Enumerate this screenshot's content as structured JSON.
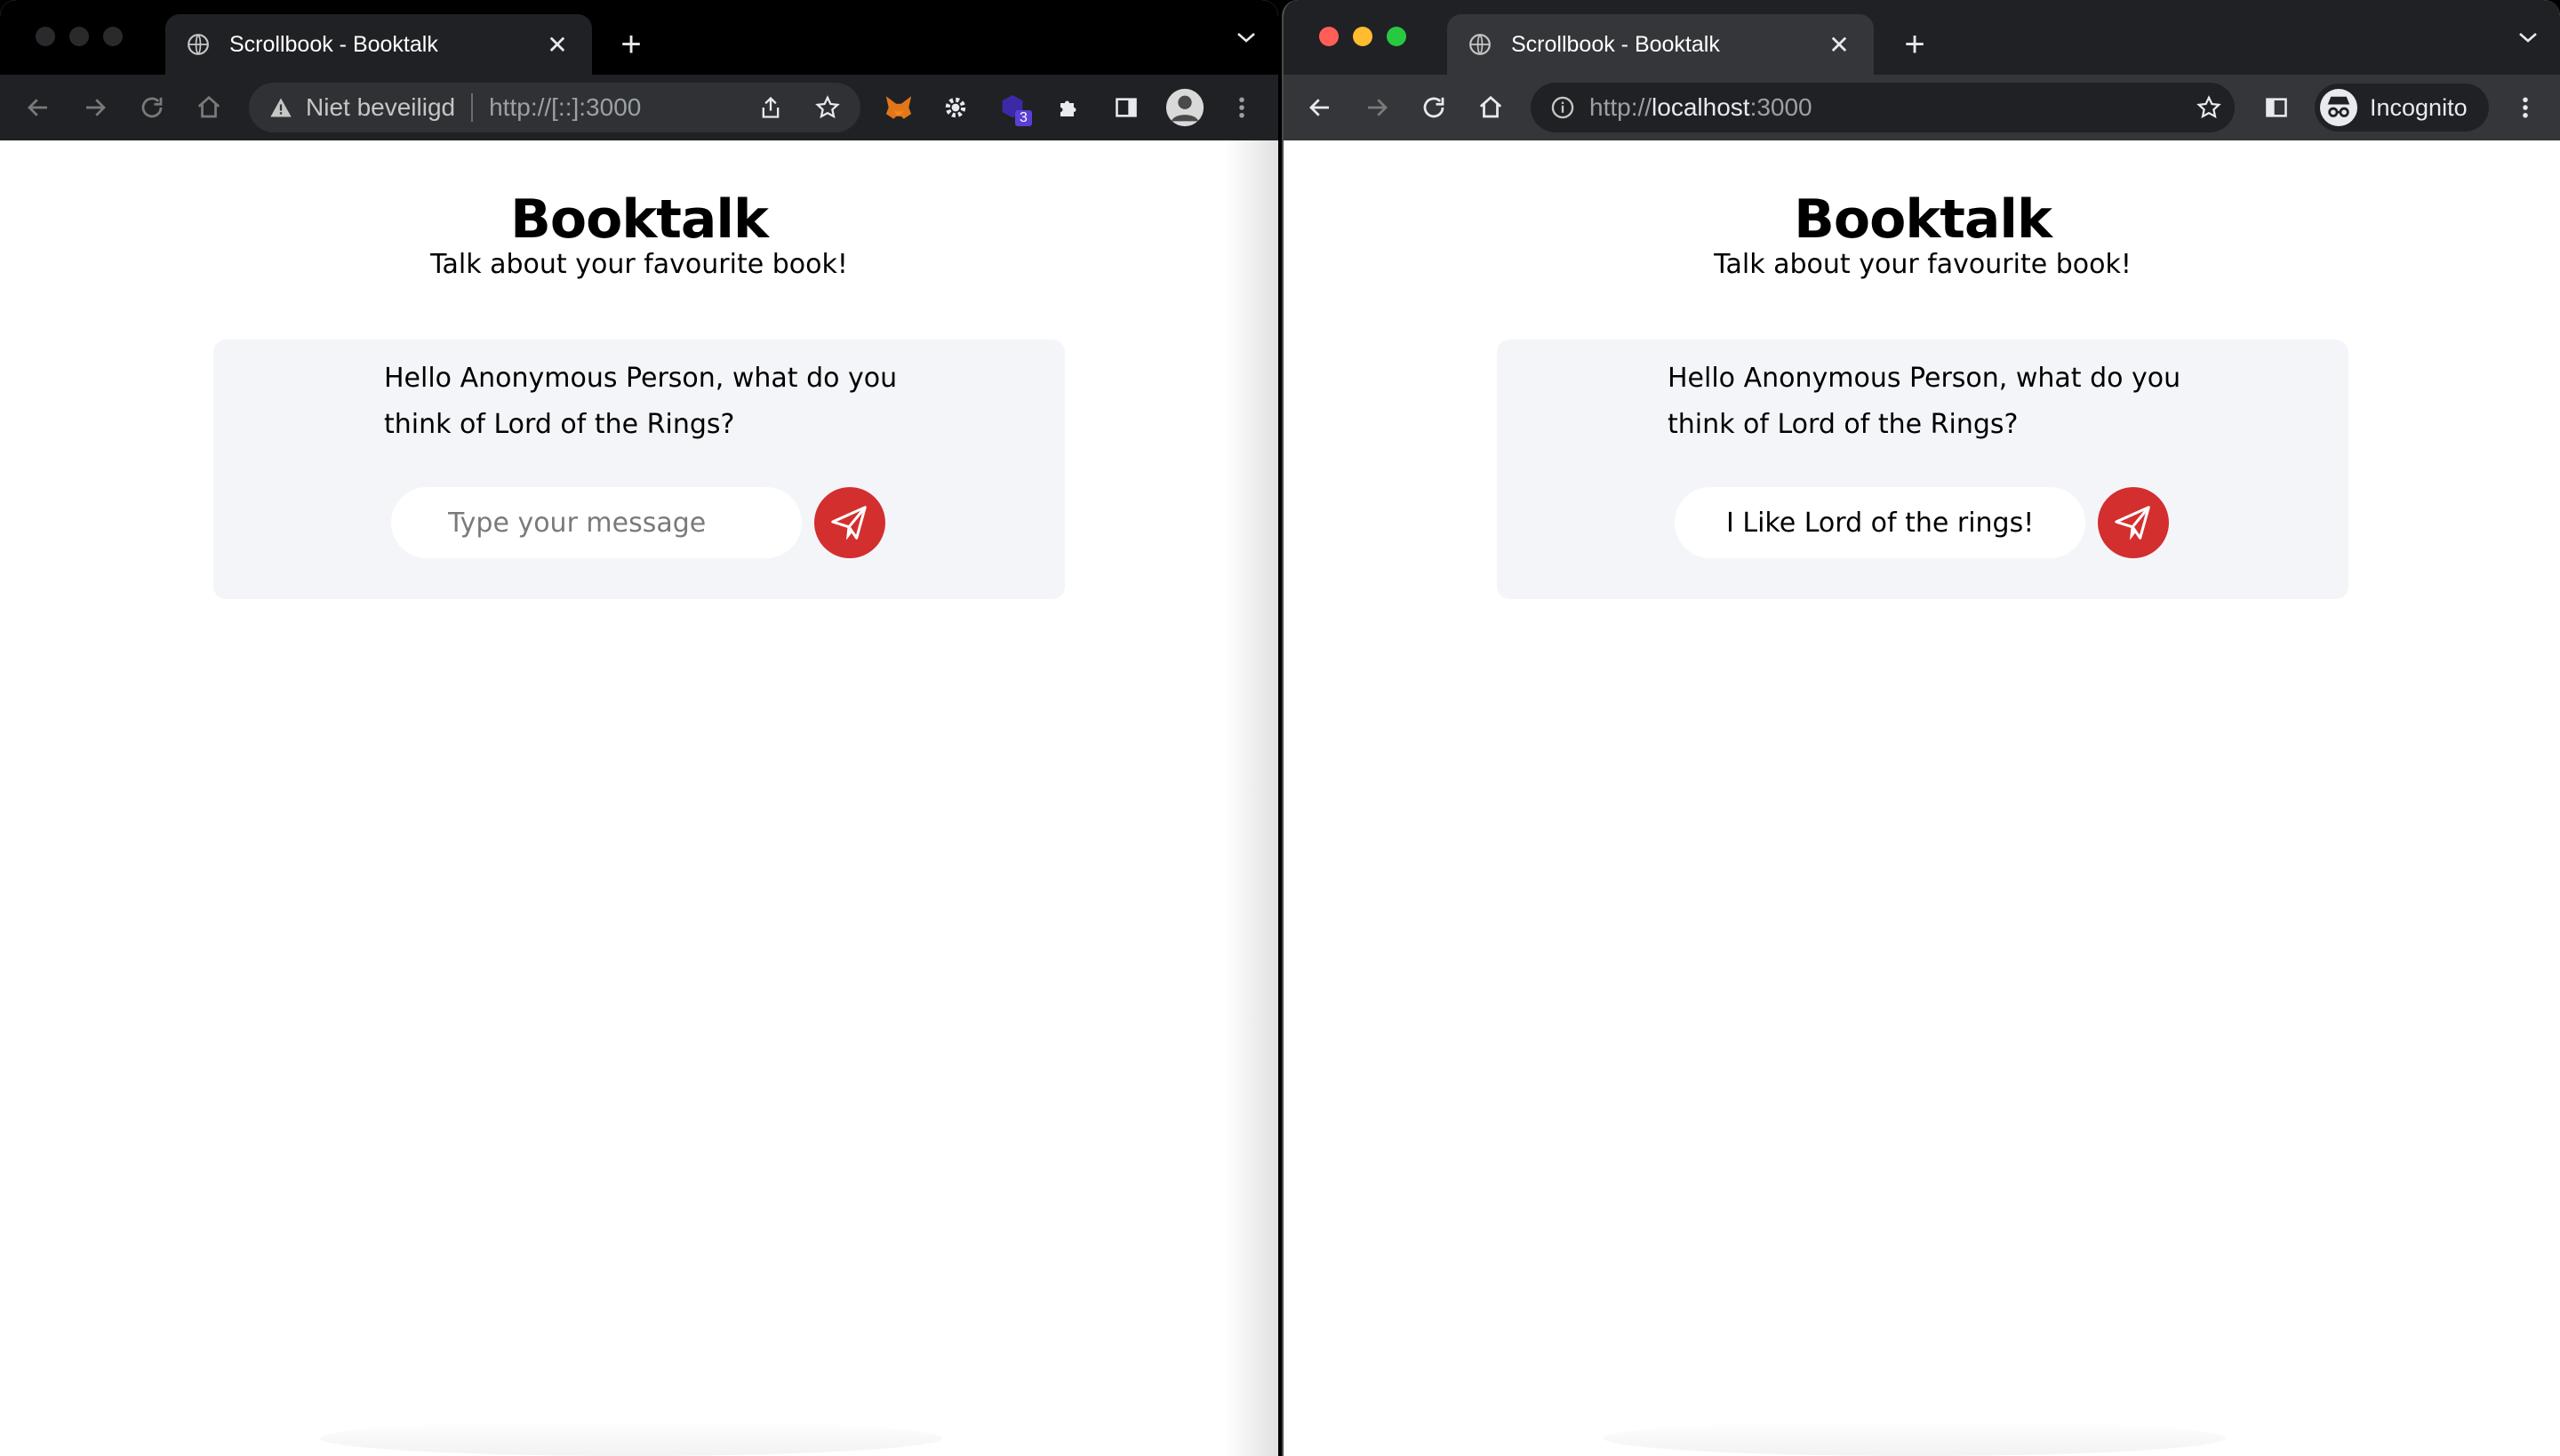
{
  "left_window": {
    "tab": {
      "title": "Scrollbook - Booktalk",
      "close": "✕"
    },
    "new_tab": "+",
    "omnibox": {
      "security_label": "Niet beveiligd",
      "url_host": "http://[::]",
      "url_port": ":3000"
    },
    "extension_badge": "3",
    "page": {
      "title": "Booktalk",
      "subtitle": "Talk about your favourite book!",
      "question": "Hello Anonymous Person, what do you think of Lord of the Rings?",
      "input_value": "",
      "input_placeholder": "Type your message"
    }
  },
  "right_window": {
    "tab": {
      "title": "Scrollbook - Booktalk",
      "close": "✕"
    },
    "new_tab": "+",
    "omnibox": {
      "url_scheme": "http://",
      "url_host": "localhost",
      "url_port": ":3000"
    },
    "incognito_label": "Incognito",
    "page": {
      "title": "Booktalk",
      "subtitle": "Talk about your favourite book!",
      "question": "Hello Anonymous Person, what do you think of Lord of the Rings?",
      "input_value": "I Like Lord of the rings!",
      "input_placeholder": "Type your message"
    }
  },
  "colors": {
    "send_button": "#d32f2f",
    "card_background": "#f4f5f9",
    "traffic_red": "#ff5f57",
    "traffic_yellow": "#febc2e",
    "traffic_green": "#28c840"
  }
}
